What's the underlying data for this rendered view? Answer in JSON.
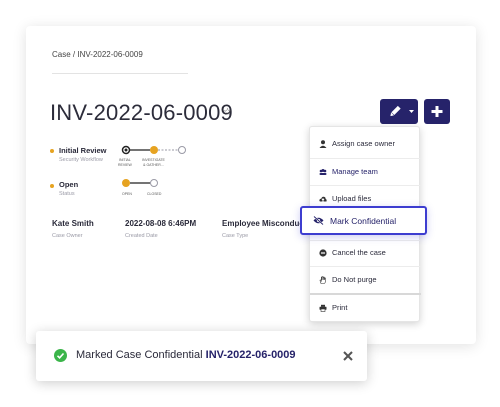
{
  "breadcrumb": {
    "section": "Case",
    "separator": "/",
    "current": "INV-2022-06-0009"
  },
  "case": {
    "title": "INV-2022-06-0009"
  },
  "workflow": [
    {
      "label": "Initial Review",
      "sub": "Security Workflow",
      "steps": [
        "INITIAL\nREVIEW",
        "INVESTIGATE\n& GATHER..."
      ]
    },
    {
      "label": "Open",
      "sub": "Status",
      "steps": [
        "OPEN",
        "CLOSED"
      ]
    }
  ],
  "meta": [
    {
      "value": "Kate Smith",
      "label": "Case Owner"
    },
    {
      "value": "2022-08-08 6:46PM",
      "label": "Created Date"
    },
    {
      "value": "Employee Misconduct",
      "label": "Case Type"
    }
  ],
  "menu": {
    "items": [
      {
        "label": "Assign case owner",
        "icon": "user-icon"
      },
      {
        "label": "Manage team",
        "icon": "team-icon"
      },
      {
        "label": "Upload files",
        "icon": "cloud-upload-icon"
      },
      {
        "label": "Mark Confidential",
        "icon": "eye-slash-icon"
      },
      {
        "label": "Cancel the case",
        "icon": "minus-circle-icon"
      },
      {
        "label": "Do Not purge",
        "icon": "hand-icon"
      },
      {
        "label": "Print",
        "icon": "print-icon"
      }
    ]
  },
  "toast": {
    "message": "Marked Case Confidential",
    "case_id": "INV-2022-06-0009"
  },
  "colors": {
    "primary": "#26236a",
    "accent": "#e6a321",
    "success": "#3bb54a",
    "highlight": "#3d3dd0"
  }
}
